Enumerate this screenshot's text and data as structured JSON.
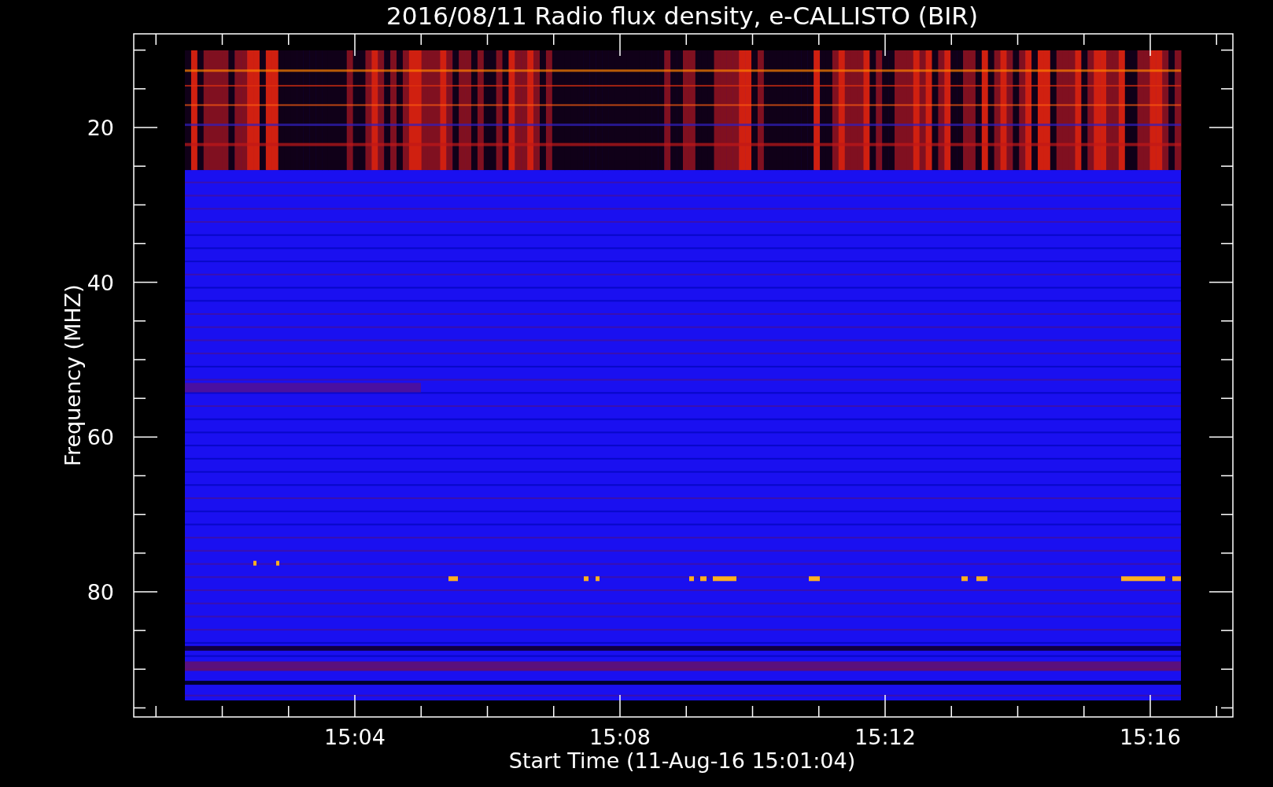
{
  "title": "2016/08/11  Radio flux density, e-CALLISTO (BIR)",
  "y_axis": {
    "label": "Frequency (MHZ)",
    "ticks": [
      "20",
      "40",
      "60",
      "80"
    ]
  },
  "x_axis": {
    "label": "Start Time (11-Aug-16 15:01:04)",
    "ticks": [
      "15:04",
      "15:08",
      "15:12",
      "15:16"
    ]
  }
}
